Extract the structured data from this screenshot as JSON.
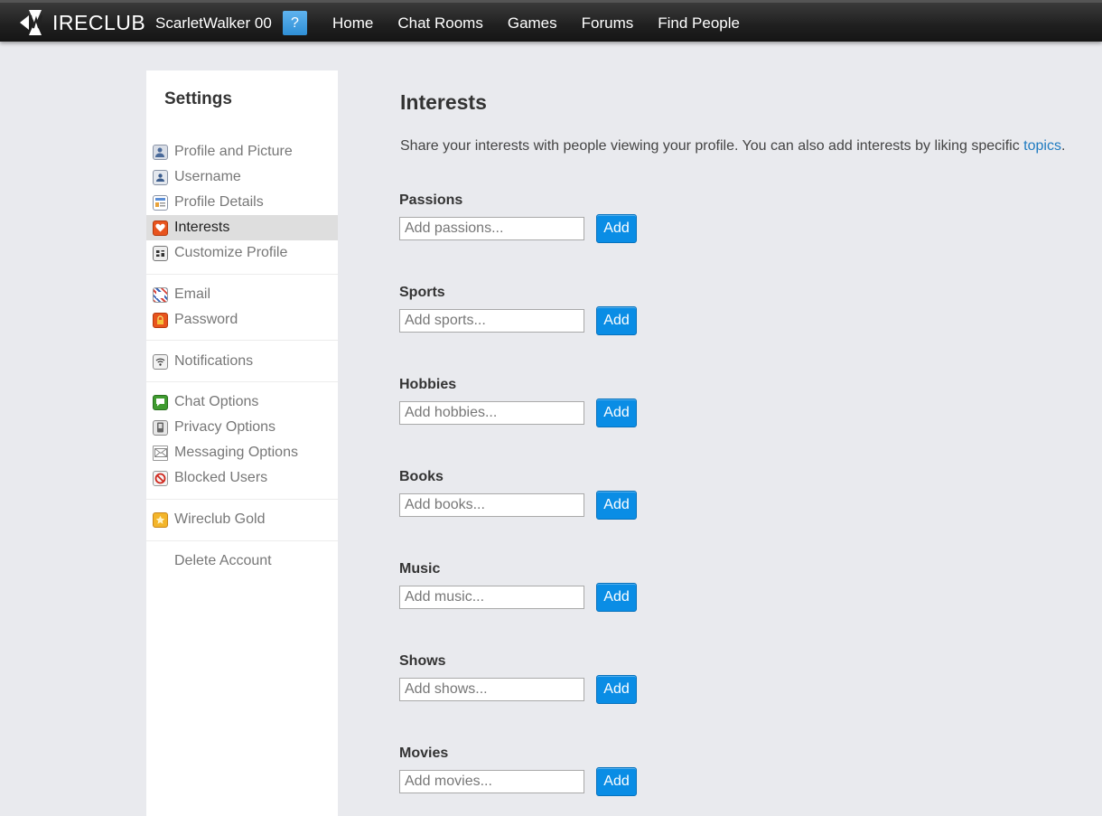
{
  "header": {
    "logo_text": "IRECLUB",
    "logo_alt": "WIRECLUB",
    "username": "ScarletWalker 00",
    "help_label": "?",
    "nav": [
      "Home",
      "Chat Rooms",
      "Games",
      "Forums",
      "Find People"
    ]
  },
  "sidebar": {
    "title": "Settings",
    "groups": [
      {
        "items": [
          {
            "label": "Profile and Picture",
            "icon": "profile-picture-icon"
          },
          {
            "label": "Username",
            "icon": "user-badge-icon"
          },
          {
            "label": "Profile Details",
            "icon": "profile-details-icon"
          },
          {
            "label": "Interests",
            "icon": "heart-icon",
            "active": true
          },
          {
            "label": "Customize Profile",
            "icon": "customize-sliders-icon"
          }
        ]
      },
      {
        "items": [
          {
            "label": "Email",
            "icon": "envelope-airmail-icon"
          },
          {
            "label": "Password",
            "icon": "lock-icon"
          }
        ]
      },
      {
        "items": [
          {
            "label": "Notifications",
            "icon": "wifi-signal-icon"
          }
        ]
      },
      {
        "items": [
          {
            "label": "Chat Options",
            "icon": "chat-bubble-icon"
          },
          {
            "label": "Privacy Options",
            "icon": "privacy-shield-icon"
          },
          {
            "label": "Messaging Options",
            "icon": "envelope-icon"
          },
          {
            "label": "Blocked Users",
            "icon": "blocked-icon"
          }
        ]
      },
      {
        "items": [
          {
            "label": "Wireclub Gold",
            "icon": "gold-star-icon"
          }
        ]
      },
      {
        "items": [
          {
            "label": "Delete Account",
            "icon": ""
          }
        ]
      }
    ]
  },
  "main": {
    "title": "Interests",
    "intro": "Share your interests with people viewing your profile. You can also add interests by liking specific ",
    "intro_link": "topics",
    "intro_end": ".",
    "add_label": "Add",
    "fields": [
      {
        "label": "Passions",
        "placeholder": "Add passions..."
      },
      {
        "label": "Sports",
        "placeholder": "Add sports..."
      },
      {
        "label": "Hobbies",
        "placeholder": "Add hobbies..."
      },
      {
        "label": "Books",
        "placeholder": "Add books..."
      },
      {
        "label": "Music",
        "placeholder": "Add music..."
      },
      {
        "label": "Shows",
        "placeholder": "Add shows..."
      },
      {
        "label": "Movies",
        "placeholder": "Add movies..."
      }
    ]
  },
  "colors": {
    "accent": "#0a8de5",
    "link": "#1f7bc1",
    "background": "#e9eaee",
    "topbar": "#1f1f1f",
    "active_item": "#dedede"
  }
}
